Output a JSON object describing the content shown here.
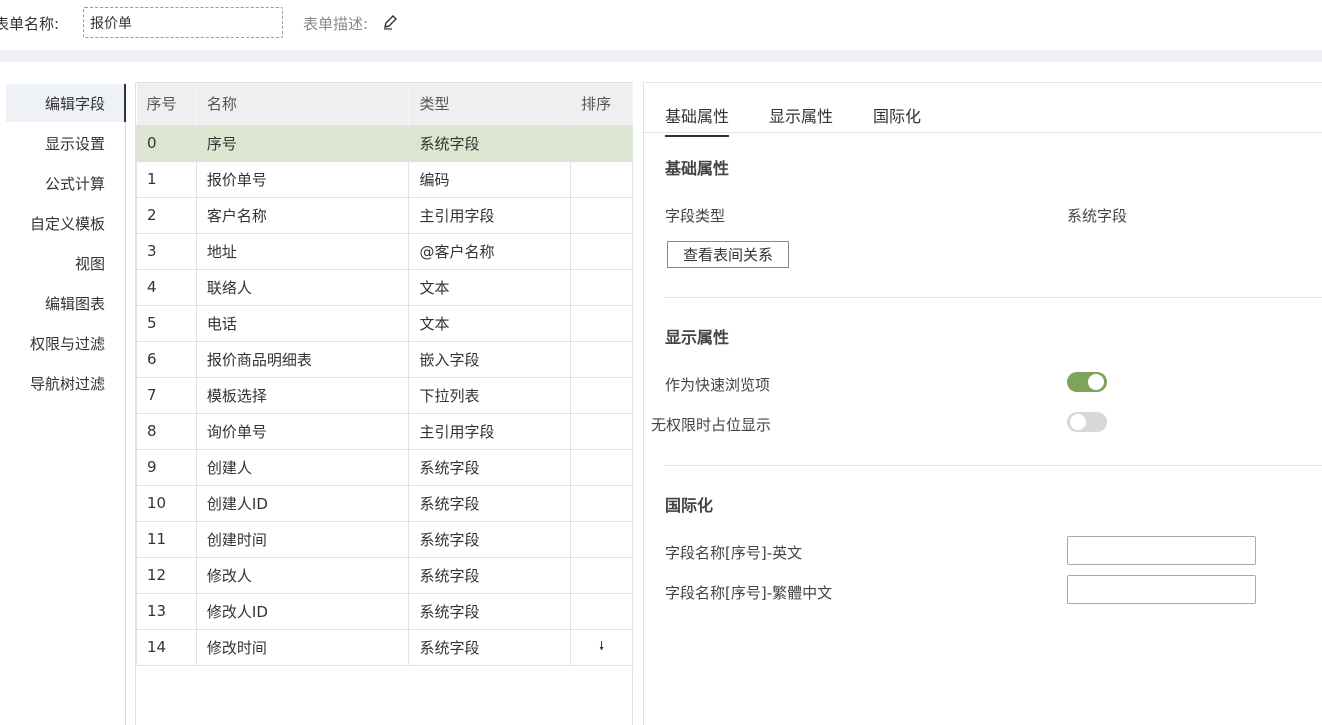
{
  "header": {
    "form_name_label": "表单名称:",
    "form_name_value": "报价单",
    "form_desc_label": "表单描述:"
  },
  "sidebar": {
    "items": [
      {
        "label": "编辑字段",
        "active": true
      },
      {
        "label": "显示设置"
      },
      {
        "label": "公式计算"
      },
      {
        "label": "自定义模板"
      },
      {
        "label": "视图"
      },
      {
        "label": "编辑图表"
      },
      {
        "label": "权限与过滤"
      },
      {
        "label": "导航树过滤"
      }
    ]
  },
  "table": {
    "columns": [
      "序号",
      "名称",
      "类型",
      "排序"
    ],
    "rows": [
      {
        "index": "0",
        "name": "序号",
        "type": "系统字段"
      },
      {
        "index": "1",
        "name": "报价单号",
        "type": "编码"
      },
      {
        "index": "2",
        "name": "客户名称",
        "type": "主引用字段"
      },
      {
        "index": "3",
        "name": "地址",
        "type": "@客户名称"
      },
      {
        "index": "4",
        "name": "联络人",
        "type": "文本"
      },
      {
        "index": "5",
        "name": "电话",
        "type": "文本"
      },
      {
        "index": "6",
        "name": "报价商品明细表",
        "type": "嵌入字段"
      },
      {
        "index": "7",
        "name": "模板选择",
        "type": "下拉列表"
      },
      {
        "index": "8",
        "name": "询价单号",
        "type": "主引用字段"
      },
      {
        "index": "9",
        "name": "创建人",
        "type": "系统字段"
      },
      {
        "index": "10",
        "name": "创建人ID",
        "type": "系统字段"
      },
      {
        "index": "11",
        "name": "创建时间",
        "type": "系统字段"
      },
      {
        "index": "12",
        "name": "修改人",
        "type": "系统字段"
      },
      {
        "index": "13",
        "name": "修改人ID",
        "type": "系统字段"
      },
      {
        "index": "14",
        "name": "修改时间",
        "type": "系统字段",
        "sort": "🠗"
      }
    ]
  },
  "panel": {
    "tabs": [
      "基础属性",
      "显示属性",
      "国际化"
    ],
    "basic": {
      "title": "基础属性",
      "field_type_label": "字段类型",
      "field_type_value": "系统字段",
      "view_relation_button": "查看表间关系"
    },
    "display": {
      "title": "显示属性",
      "quick_browse_label": "作为快速浏览项",
      "quick_browse_on": true,
      "placeholder_label": "无权限时占位显示",
      "placeholder_on": false
    },
    "i18n": {
      "title": "国际化",
      "english_label": "字段名称[序号]-英文",
      "traditional_label": "字段名称[序号]-繁體中文",
      "english_value": "",
      "traditional_value": ""
    }
  },
  "colors": {
    "highlight_row": "#dce5cf",
    "toggle_on": "#7ea35a",
    "toggle_off": "#d8d8d8"
  }
}
